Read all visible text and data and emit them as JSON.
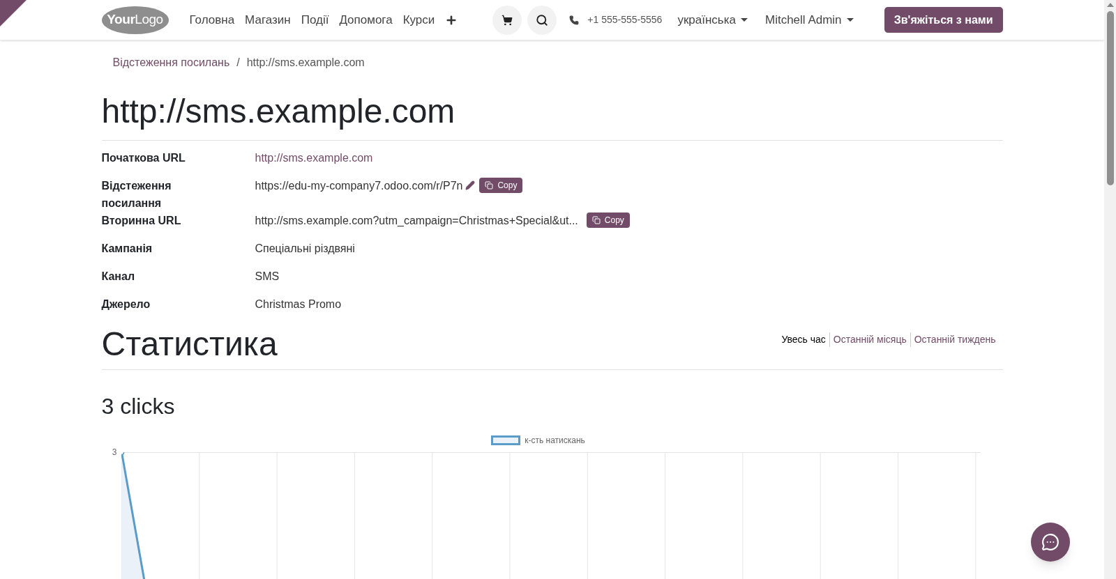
{
  "nav": {
    "logo_text": [
      "Your",
      "Logo"
    ],
    "menu": [
      {
        "label": "Головна"
      },
      {
        "label": "Магазин"
      },
      {
        "label": "Події"
      },
      {
        "label": "Допомога"
      },
      {
        "label": "Курси"
      }
    ],
    "phone": "+1 555-555-5556",
    "language": "українська",
    "user": "Mitchell Admin",
    "contact_button": "Зв'яжіться з нами"
  },
  "breadcrumb": [
    {
      "label": "Відстеження посилань",
      "link": true
    },
    {
      "label": "http://sms.example.com",
      "link": false
    }
  ],
  "breadcrumb_separator": "/",
  "title": "http://sms.example.com",
  "fields": [
    {
      "label": "Початкова URL",
      "value": "http://sms.example.com",
      "kind": "link"
    },
    {
      "label": "Відстеження посилання",
      "value": "https://edu-my-company7.odoo.com/r/P7n",
      "kind": "editable",
      "copy": "Copy"
    },
    {
      "label": "Вторинна URL",
      "value": "http://sms.example.com?utm_campaign=Christmas+Special&ut...",
      "kind": "copy",
      "copy": "Copy"
    },
    {
      "label": "Кампанія",
      "value": "Спеціальні різдвяні",
      "kind": "text"
    },
    {
      "label": "Канал",
      "value": "SMS",
      "kind": "text"
    },
    {
      "label": "Джерело",
      "value": "Christmas Promo",
      "kind": "text"
    }
  ],
  "statistics": {
    "title": "Статистика",
    "periods": [
      {
        "label": "Увесь час",
        "selected": true
      },
      {
        "label": "Останній місяць",
        "selected": false
      },
      {
        "label": "Останній тиждень",
        "selected": false
      }
    ],
    "clicks": "3 clicks",
    "chart": {
      "legend": "к-сть натискань",
      "y_tick_label": "3",
      "color": "#5b9bc8"
    }
  }
}
